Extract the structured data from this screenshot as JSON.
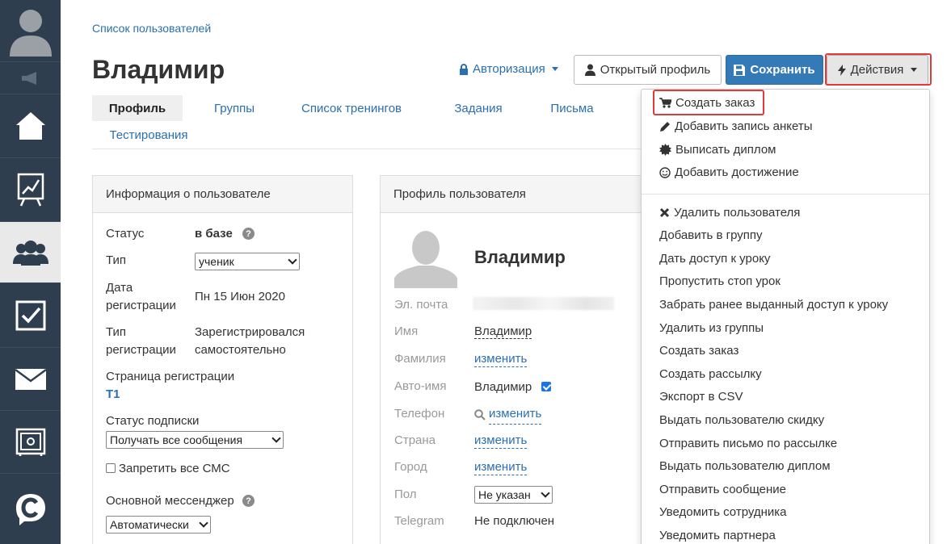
{
  "sidebar": {
    "items": [
      {
        "name": "avatar"
      },
      {
        "name": "announcements"
      },
      {
        "name": "home"
      },
      {
        "name": "statistics"
      },
      {
        "name": "users",
        "active": true
      },
      {
        "name": "tasks"
      },
      {
        "name": "mail"
      },
      {
        "name": "safe"
      },
      {
        "name": "logo"
      }
    ],
    "bg_color": "#2f3e4e"
  },
  "breadcrumb": "Список пользователей",
  "title": "Владимир",
  "header": {
    "auth_label": "Авторизация",
    "open_profile_label": "Открытый профиль",
    "save_label": "Сохранить",
    "actions_label": "Действия"
  },
  "tabs": [
    "Профиль",
    "Группы",
    "Список тренингов",
    "Задания",
    "Письма",
    "Тестирования"
  ],
  "info_panel": {
    "title": "Информация о пользователе",
    "status_label": "Статус",
    "status_value": "в базе",
    "type_label": "Тип",
    "type_value": "ученик",
    "reg_date_label_1": "Дата",
    "reg_date_label_2": "регистрации",
    "reg_date_value": "Пн 15 Июн 2020",
    "reg_type_label_1": "Тип",
    "reg_type_label_2": "регистрации",
    "reg_type_value_1": "Зарегистрировался",
    "reg_type_value_2": "самостоятельно",
    "reg_page_label": "Страница регистрации",
    "reg_page_value": "T1",
    "sub_status_label": "Статус подписки",
    "sub_status_value": "Получать все сообщения",
    "sms_label": "Запретить все СМС",
    "messenger_label": "Основной мессенджер",
    "messenger_value": "Автоматически"
  },
  "profile_panel": {
    "title": "Профиль пользователя",
    "name": "Владимир",
    "email_label": "Эл. почта",
    "name_label": "Имя",
    "name_value": "Владимир",
    "surname_label": "Фамилия",
    "change": "изменить",
    "autoname_label": "Авто-имя",
    "autoname_value": "Владимир",
    "phone_label": "Телефон",
    "country_label": "Страна",
    "city_label": "Город",
    "gender_label": "Пол",
    "gender_value": "Не указан",
    "telegram_label": "Telegram",
    "telegram_value": "Не подключен"
  },
  "actions_menu": {
    "top": [
      {
        "label": "Создать заказ",
        "icon": "cart-icon"
      },
      {
        "label": "Добавить запись анкеты",
        "icon": "pencil-icon"
      },
      {
        "label": "Выписать диплом",
        "icon": "certificate-icon"
      },
      {
        "label": "Добавить достижение",
        "icon": "smile-icon"
      }
    ],
    "bottom": [
      "Удалить пользователя",
      "Добавить в группу",
      "Дать доступ к уроку",
      "Пропустить стоп урок",
      "Забрать ранее выданный доступ к уроку",
      "Удалить из группы",
      "Создать заказ",
      "Создать рассылку",
      "Экспорт в CSV",
      "Выдать пользователю скидку",
      "Отправить письмо по рассылке",
      "Выдать пользователю диплом",
      "Отправить сообщение",
      "Уведомить сотрудника",
      "Уведомить партнера"
    ]
  },
  "colors": {
    "link": "#2a6fb0",
    "primary_button": "#337ab7",
    "highlight": "#e13a3a"
  }
}
